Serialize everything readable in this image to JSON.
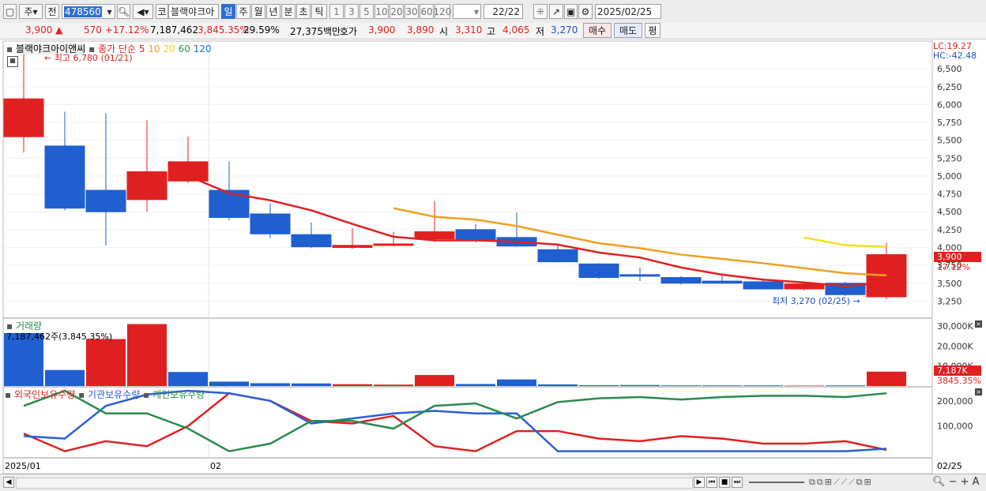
{
  "toolbar": {
    "market": "주",
    "prev_label": "전",
    "code": "478560",
    "kr_label": "코",
    "stock_name": "블랙야크아",
    "periods": [
      "일",
      "주",
      "월",
      "년",
      "분",
      "초",
      "틱"
    ],
    "active_period": "일",
    "minutes": [
      "1",
      "3",
      "5",
      "10",
      "20",
      "30",
      "60",
      "120"
    ],
    "page": "22/22",
    "date": "2025/02/25"
  },
  "quote": {
    "price": "3,900 ▲",
    "change": "570 +17.12%",
    "volume": "7,187,462",
    "volume_pct": "3,845.35%",
    "turnover_pct": "29.59%",
    "trade_amount": "27,375백만",
    "bid_label": "호가",
    "ask": "3,900",
    "bid": "3,890",
    "open_label": "시",
    "open": "3,310",
    "high_label": "고",
    "high": "4,065",
    "low_label": "저",
    "low": "3,270",
    "buy_button": "매수",
    "sell_button": "매도",
    "eval_button": "평"
  },
  "price_panel": {
    "legend_name": "블랙야크아이앤씨",
    "legend_ma_label": "종가 단순",
    "ma_periods": [
      "5",
      "10",
      "20",
      "60",
      "120"
    ],
    "ma_colors": [
      "#e02020",
      "#f0a020",
      "#f0e020",
      "#20a050",
      "#2070d0"
    ],
    "lc_label": "LC:19.27",
    "hc_label": "HC:-42.48",
    "high_note": "최고 6,780 (01/21)",
    "low_note": "최저 3,270 (02/25)",
    "current_price_tag": "3,900",
    "current_change_tag": "17.12%"
  },
  "volume_panel": {
    "title": "거래량",
    "value_note": "7,187,462주(3,845.35%)",
    "current_tag": "7,187K",
    "current_pct_tag": "3845.35%"
  },
  "holdings_panel": {
    "legend": [
      "외국인보유수량",
      "기관보유수량",
      "개인보유수량"
    ],
    "colors": [
      "#e02020",
      "#2a5fd8",
      "#2a8a50"
    ]
  },
  "x_labels": {
    "start": "2025/01",
    "mid": "02",
    "end": "02/25"
  },
  "chart_data": [
    {
      "type": "candlestick",
      "title": "블랙야크아이앤씨",
      "ylim": [
        3100,
        6800
      ],
      "yticks": [
        3250,
        3500,
        3750,
        4000,
        4250,
        4500,
        4750,
        5000,
        5250,
        5500,
        5750,
        6000,
        6250,
        6500
      ],
      "candles": [
        {
          "open": 5550,
          "close": 6080,
          "high": 6780,
          "low": 5330
        },
        {
          "open": 5420,
          "close": 4550,
          "high": 5900,
          "low": 4520
        },
        {
          "open": 4800,
          "close": 4500,
          "high": 5880,
          "low": 4030
        },
        {
          "open": 4670,
          "close": 5060,
          "high": 5780,
          "low": 4500
        },
        {
          "open": 4930,
          "close": 5200,
          "high": 5550,
          "low": 4900
        },
        {
          "open": 4800,
          "close": 4420,
          "high": 5200,
          "low": 4380
        },
        {
          "open": 4470,
          "close": 4190,
          "high": 4620,
          "low": 4130
        },
        {
          "open": 4180,
          "close": 4010,
          "high": 4350,
          "low": 3990
        },
        {
          "open": 4000,
          "close": 4030,
          "high": 4270,
          "low": 3980
        },
        {
          "open": 4030,
          "close": 4050,
          "high": 4220,
          "low": 4020
        },
        {
          "open": 4120,
          "close": 4220,
          "high": 4650,
          "low": 4080
        },
        {
          "open": 4250,
          "close": 4100,
          "high": 4330,
          "low": 4070
        },
        {
          "open": 4140,
          "close": 4020,
          "high": 4490,
          "low": 4010
        },
        {
          "open": 3970,
          "close": 3800,
          "high": 4050,
          "low": 3790
        },
        {
          "open": 3770,
          "close": 3580,
          "high": 3780,
          "low": 3560
        },
        {
          "open": 3620,
          "close": 3600,
          "high": 3720,
          "low": 3530
        },
        {
          "open": 3580,
          "close": 3500,
          "high": 3600,
          "low": 3480
        },
        {
          "open": 3530,
          "close": 3500,
          "high": 3620,
          "low": 3490
        },
        {
          "open": 3520,
          "close": 3420,
          "high": 3560,
          "low": 3410
        },
        {
          "open": 3420,
          "close": 3490,
          "high": 3520,
          "low": 3400
        },
        {
          "open": 3500,
          "close": 3340,
          "high": 3520,
          "low": 3320
        },
        {
          "open": 3310,
          "close": 3900,
          "high": 4065,
          "low": 3270
        }
      ],
      "series": [
        {
          "name": "5",
          "values": [
            null,
            null,
            null,
            null,
            5000,
            4760,
            4660,
            4520,
            4330,
            4150,
            4100,
            4100,
            4080,
            4040,
            3930,
            3860,
            3720,
            3620,
            3550,
            3510,
            3460,
            3510
          ]
        },
        {
          "name": "10",
          "values": [
            null,
            null,
            null,
            null,
            null,
            null,
            null,
            null,
            null,
            4550,
            4430,
            4390,
            4300,
            4180,
            4060,
            3990,
            3900,
            3840,
            3780,
            3710,
            3640,
            3610
          ]
        },
        {
          "name": "20",
          "values": [
            null,
            null,
            null,
            null,
            null,
            null,
            null,
            null,
            null,
            null,
            null,
            null,
            null,
            null,
            null,
            null,
            null,
            null,
            null,
            4140,
            4030,
            4010
          ]
        }
      ]
    },
    {
      "type": "bar",
      "title": "거래량",
      "ylim": [
        0,
        32000
      ],
      "yticks": [
        10000,
        20000,
        30000
      ],
      "unit": "K",
      "values": [
        26500,
        8000,
        23500,
        31000,
        7000,
        2200,
        1400,
        1300,
        900,
        700,
        5500,
        1000,
        3300,
        800,
        400,
        500,
        300,
        300,
        300,
        200,
        300,
        7187
      ],
      "rising": [
        false,
        false,
        true,
        true,
        false,
        false,
        false,
        false,
        true,
        true,
        true,
        false,
        false,
        false,
        false,
        false,
        false,
        false,
        false,
        true,
        false,
        true
      ]
    },
    {
      "type": "line",
      "title": "보유수량",
      "ylim": [
        -20000,
        240000
      ],
      "yticks": [
        100000,
        200000
      ],
      "series": [
        {
          "name": "외국인보유수량",
          "values": [
            70000,
            0,
            40000,
            20000,
            100000,
            230000,
            200000,
            120000,
            110000,
            140000,
            20000,
            0,
            80000,
            80000,
            50000,
            40000,
            60000,
            50000,
            30000,
            30000,
            40000,
            5000
          ]
        },
        {
          "name": "기관보유수량",
          "values": [
            60000,
            50000,
            180000,
            225000,
            240000,
            230000,
            200000,
            110000,
            130000,
            150000,
            160000,
            150000,
            150000,
            0,
            0,
            0,
            0,
            0,
            0,
            0,
            0,
            10000
          ]
        },
        {
          "name": "개인보유수량",
          "values": [
            180000,
            240000,
            150000,
            150000,
            90000,
            0,
            30000,
            120000,
            120000,
            90000,
            180000,
            190000,
            130000,
            195000,
            210000,
            215000,
            205000,
            215000,
            220000,
            220000,
            215000,
            230000
          ]
        }
      ]
    }
  ]
}
